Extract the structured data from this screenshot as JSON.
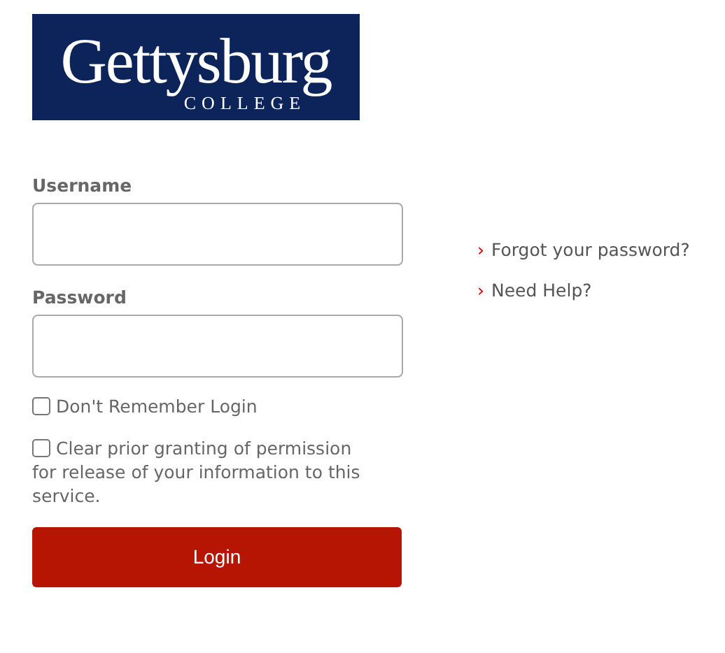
{
  "logo": {
    "name": "Gettysburg",
    "subtitle": "COLLEGE"
  },
  "fields": [
    {
      "label": "Username"
    },
    {
      "label": "Password"
    }
  ],
  "checkboxes": [
    {
      "label": "Don't Remember Login",
      "checked": false
    },
    {
      "label": "Clear prior granting of permission for release of your information to this service.",
      "checked": false
    }
  ],
  "login_button": "Login",
  "links": [
    {
      "marker": "›",
      "text": "Forgot your password?"
    },
    {
      "marker": "›",
      "text": "Need Help?"
    }
  ]
}
